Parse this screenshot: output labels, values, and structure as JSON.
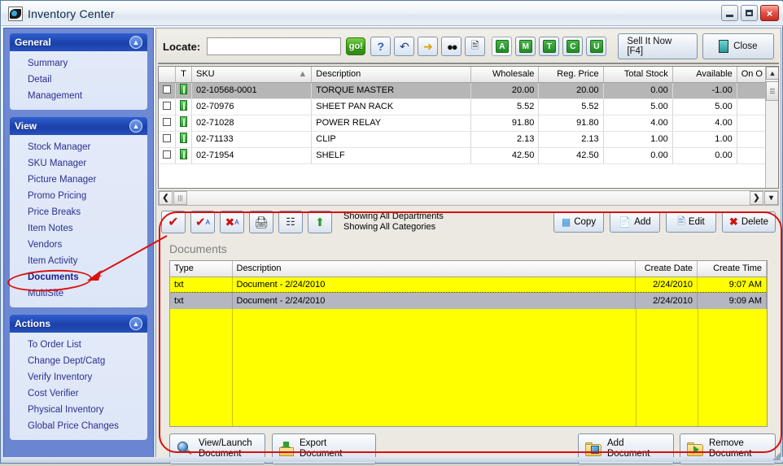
{
  "window": {
    "title": "Inventory Center",
    "icon": "app-swoosh-icon",
    "minimize_label": "_",
    "maximize_label": "□",
    "close_label": "×"
  },
  "sidebar": {
    "groups": [
      {
        "title": "General",
        "collapse_icon": "chevron-up-icon",
        "items": [
          {
            "label": "Summary"
          },
          {
            "label": "Detail"
          },
          {
            "label": "Management"
          }
        ]
      },
      {
        "title": "View",
        "collapse_icon": "chevron-up-icon",
        "items": [
          {
            "label": "Stock Manager"
          },
          {
            "label": "SKU Manager"
          },
          {
            "label": "Picture Manager"
          },
          {
            "label": "Promo Pricing"
          },
          {
            "label": "Price Breaks"
          },
          {
            "label": "Item Notes"
          },
          {
            "label": "Vendors"
          },
          {
            "label": "Item Activity"
          },
          {
            "label": "Documents"
          },
          {
            "label": "MultiSite"
          }
        ]
      },
      {
        "title": "Actions",
        "collapse_icon": "chevron-up-icon",
        "items": [
          {
            "label": "To Order List"
          },
          {
            "label": "Change Dept/Catg"
          },
          {
            "label": "Verify Inventory"
          },
          {
            "label": "Cost Verifier"
          },
          {
            "label": "Physical Inventory"
          },
          {
            "label": "Global Price Changes"
          }
        ]
      }
    ]
  },
  "locate_bar": {
    "label": "Locate:",
    "input_value": "",
    "input_placeholder": "",
    "go_label": "go!",
    "tools": [
      {
        "name": "help-icon",
        "glyph": "?"
      },
      {
        "name": "refresh-icon",
        "glyph": "↺"
      },
      {
        "name": "jump-arrow-icon",
        "glyph": "↖"
      },
      {
        "name": "binoculars-icon",
        "glyph": "☎"
      },
      {
        "name": "preview-icon",
        "glyph": "☰"
      }
    ],
    "letters": [
      "A",
      "M",
      "T",
      "C",
      "U"
    ],
    "sell_now_label": "Sell It Now [F4]",
    "close_label": "Close",
    "close_icon": "exit-door-icon"
  },
  "inventory_grid": {
    "columns": [
      "",
      "T",
      "SKU",
      "Description",
      "Wholesale",
      "Reg. Price",
      "Total Stock",
      "Available",
      "On O"
    ],
    "sort_column": "SKU",
    "sort_icon": "sort-asc-icon",
    "rows": [
      {
        "checked": false,
        "type": "active",
        "sku": "02-10568-0001",
        "description": "TORQUE MASTER",
        "wholesale": "20.00",
        "reg_price": "20.00",
        "total_stock": "0.00",
        "available": "-1.00",
        "on_o": "",
        "selected": true
      },
      {
        "checked": false,
        "type": "active",
        "sku": "02-70976",
        "description": "SHEET PAN RACK",
        "wholesale": "5.52",
        "reg_price": "5.52",
        "total_stock": "5.00",
        "available": "5.00",
        "on_o": "",
        "selected": false
      },
      {
        "checked": false,
        "type": "active",
        "sku": "02-71028",
        "description": "POWER RELAY",
        "wholesale": "91.80",
        "reg_price": "91.80",
        "total_stock": "4.00",
        "available": "4.00",
        "on_o": "",
        "selected": false
      },
      {
        "checked": false,
        "type": "active",
        "sku": "02-71133",
        "description": "CLIP",
        "wholesale": "2.13",
        "reg_price": "2.13",
        "total_stock": "1.00",
        "available": "1.00",
        "on_o": "",
        "selected": false
      },
      {
        "checked": false,
        "type": "active",
        "sku": "02-71954",
        "description": "SHELF",
        "wholesale": "42.50",
        "reg_price": "42.50",
        "total_stock": "0.00",
        "available": "0.00",
        "on_o": "",
        "selected": false
      }
    ]
  },
  "action_bar": {
    "icons": [
      {
        "name": "check-icon",
        "glyph": "✔"
      },
      {
        "name": "check-all-icon",
        "glyph": "✔"
      },
      {
        "name": "uncheck-all-icon",
        "glyph": "✘"
      },
      {
        "name": "print-icon",
        "glyph": "⎙"
      },
      {
        "name": "grid-view-icon",
        "glyph": "☰"
      },
      {
        "name": "export-up-icon",
        "glyph": "↑"
      }
    ],
    "status_line_1": "Showing All Departments",
    "status_line_2": "Showing All Categories",
    "buttons": [
      {
        "label": "Copy",
        "icon": "copy-grid-icon"
      },
      {
        "label": "Add",
        "icon": "page-add-icon"
      },
      {
        "label": "Edit",
        "icon": "page-edit-icon"
      },
      {
        "label": "Delete",
        "icon": "delete-x-icon"
      }
    ]
  },
  "documents": {
    "title": "Documents",
    "columns": [
      "Type",
      "Description",
      "Create Date",
      "Create Time"
    ],
    "rows": [
      {
        "type": "txt",
        "description": "Document -  2/24/2010",
        "create_date": "2/24/2010",
        "create_time": "9:07 AM",
        "selected": false
      },
      {
        "type": "txt",
        "description": "Document -  2/24/2010",
        "create_date": "2/24/2010",
        "create_time": "9:09 AM",
        "selected": true
      }
    ],
    "buttons": [
      {
        "line1": "View/Launch",
        "line2": "Document",
        "icon": "magnifier-icon"
      },
      {
        "line1": "Export",
        "line2": "Document",
        "icon": "folder-download-icon"
      },
      {
        "line1": "Add",
        "line2": "Document",
        "icon": "folder-add-icon"
      },
      {
        "line1": "Remove",
        "line2": "Document",
        "icon": "folder-remove-icon"
      }
    ]
  },
  "annotations": {
    "ellipse_target": "Documents",
    "color": "#d81010"
  }
}
